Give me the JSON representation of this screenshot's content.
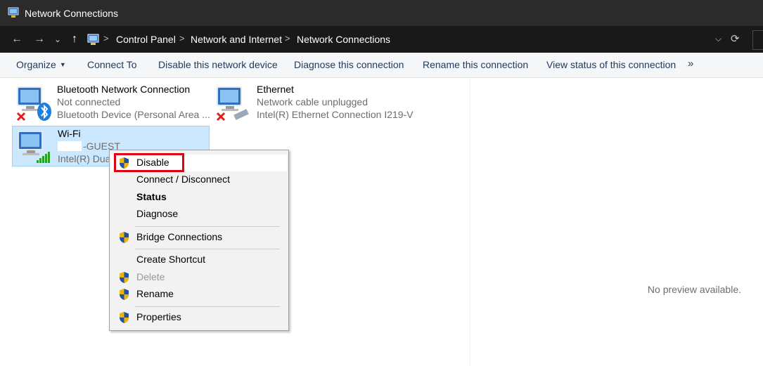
{
  "window": {
    "title": "Network Connections"
  },
  "address": {
    "crumbs": [
      "Control Panel",
      "Network and Internet",
      "Network Connections"
    ],
    "separator": ">"
  },
  "nav": {
    "back": "←",
    "forward": "→",
    "recent": "⌄",
    "up": "↑"
  },
  "toolbar": {
    "organize": "Organize",
    "connect_to": "Connect To",
    "disable_device": "Disable this network device",
    "diagnose": "Diagnose this connection",
    "rename": "Rename this connection",
    "view_status": "View status of this connection",
    "more": "»"
  },
  "connections": [
    {
      "name": "Bluetooth Network Connection",
      "status": "Not connected",
      "device": "Bluetooth Device (Personal Area ..."
    },
    {
      "name": "Ethernet",
      "status": "Network cable unplugged",
      "device": "Intel(R) Ethernet Connection I219-V"
    },
    {
      "name": "Wi-Fi",
      "status": "-GUEST",
      "device": "Intel(R) Dual"
    }
  ],
  "context_menu": {
    "disable": "Disable",
    "connect_disconnect": "Connect / Disconnect",
    "status": "Status",
    "diagnose": "Diagnose",
    "bridge": "Bridge Connections",
    "create_shortcut": "Create Shortcut",
    "delete": "Delete",
    "rename": "Rename",
    "properties": "Properties"
  },
  "preview": {
    "text": "No preview available."
  },
  "colors": {
    "highlight": "#e1000f",
    "selection": "#cce8ff",
    "titlebar": "#2b2b2b"
  }
}
